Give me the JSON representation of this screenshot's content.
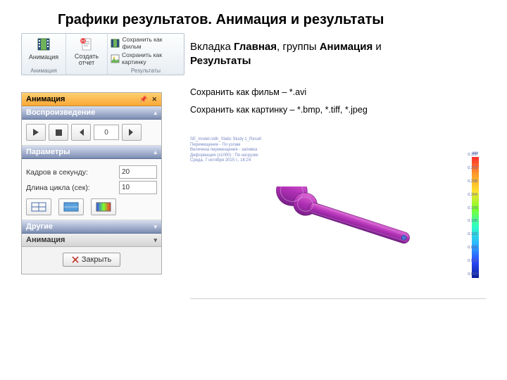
{
  "title": "Графики результатов. Анимация и результаты",
  "subtitle_parts": {
    "p1": "Вкладка ",
    "b1": "Главная",
    "p2": ", группы ",
    "b2": "Анимация",
    "p3": " и ",
    "b3": "Результаты"
  },
  "notes": {
    "n1": "Сохранить как фильм – *.avi",
    "n2": "Сохранить как картинку – *.bmp, *.tiff, *.jpeg"
  },
  "ribbon": {
    "anim_label": "Анимация",
    "anim_group": "Анимация",
    "report_label": "Создать\nотчет",
    "results_group": "Результаты",
    "save_movie": "Сохранить как фильм",
    "save_pic": "Сохранить как картинку"
  },
  "panel": {
    "h_anim": "Анимация",
    "h_play": "Воспроизведение",
    "h_params": "Параметры",
    "h_other": "Другие",
    "h_anim2": "Анимация",
    "frame_pos": "0",
    "fps_label": "Кадров в секунду:",
    "fps_value": "20",
    "cycle_label": "Длина цикла (сек):",
    "cycle_value": "10",
    "close": "Закрыть"
  },
  "preview_meta": "SE_model.sldlr_Static Study 1_Result\nПеремещение - По узлам\nВеличина перемещения - заливка\nДеформация (x1000) : По нагрузке\nСреда, 7 октября 2015 г., 16:24",
  "legend_title": "мм",
  "legend_ticks": [
    "0.306",
    "0.272",
    "0.238",
    "0.204",
    "0.170",
    "0.136",
    "0.102",
    "0.068",
    "0.034",
    "0.000"
  ]
}
